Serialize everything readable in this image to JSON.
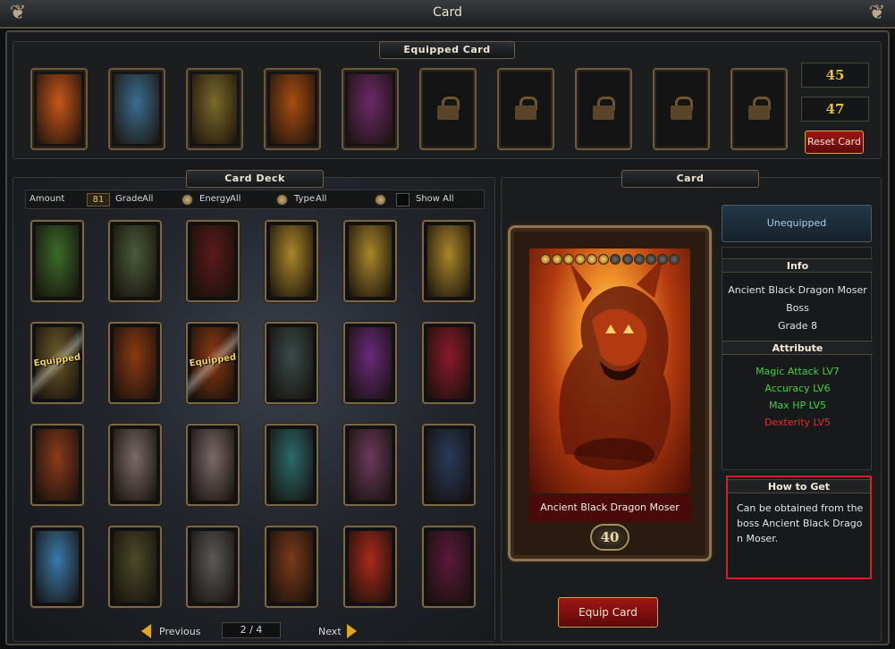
{
  "window": {
    "title": "Card"
  },
  "equipped": {
    "header": "Equipped Card",
    "slots": [
      {
        "filled": true,
        "icon": "fire-dragon-card-art",
        "color": "#c8561a"
      },
      {
        "filled": true,
        "icon": "alien-mage-card-art",
        "color": "#3a6e8f"
      },
      {
        "filled": true,
        "icon": "tiki-mask-card-art",
        "color": "#7a6a2a"
      },
      {
        "filled": true,
        "icon": "warrior-card-art",
        "color": "#a84d12"
      },
      {
        "filled": true,
        "icon": "carnivorous-plant-card-art",
        "color": "#6a2a6a"
      },
      {
        "filled": false,
        "icon": "lock-icon"
      },
      {
        "filled": false,
        "icon": "lock-icon"
      },
      {
        "filled": false,
        "icon": "lock-icon"
      },
      {
        "filled": false,
        "icon": "lock-icon"
      },
      {
        "filled": false,
        "icon": "lock-icon"
      }
    ],
    "value_top": "45",
    "value_bottom": "47",
    "reset_label": "Reset Card"
  },
  "deck": {
    "header": "Card Deck",
    "filters": {
      "amount_label": "Amount",
      "amount_value": "81",
      "grade_label": "Grade",
      "grade_value": "All",
      "energy_label": "Energy",
      "energy_value": "All",
      "type_label": "Type",
      "type_value": "All",
      "show_label": "Show All"
    },
    "cards": [
      {
        "icon": "green-beast-card-art",
        "color": "#3c6a2a",
        "equipped": false
      },
      {
        "icon": "hooded-mage-card-art",
        "color": "#4a5a3a",
        "equipped": false
      },
      {
        "icon": "dark-knight-card-art",
        "color": "#5a1a1a",
        "equipped": false
      },
      {
        "icon": "golden-orb-card-art",
        "color": "#a8862a",
        "equipped": false
      },
      {
        "icon": "golden-orb-card-art",
        "color": "#a8862a",
        "equipped": false
      },
      {
        "icon": "golden-orb-card-art",
        "color": "#a8862a",
        "equipped": false
      },
      {
        "icon": "tiki-mask-card-art",
        "color": "#6a5a2a",
        "equipped": true
      },
      {
        "icon": "warrior-card-art",
        "color": "#8a3a12",
        "equipped": false
      },
      {
        "icon": "warrior-card-art",
        "color": "#8a3a12",
        "equipped": true
      },
      {
        "icon": "armored-knight-card-art",
        "color": "#3a4a4a",
        "equipped": false
      },
      {
        "icon": "purple-demon-card-art",
        "color": "#6a2a7a",
        "equipped": false
      },
      {
        "icon": "red-demon-card-art",
        "color": "#8a1a2a",
        "equipped": false
      },
      {
        "icon": "horned-beast-card-art",
        "color": "#8a3a1a",
        "equipped": false
      },
      {
        "icon": "dwarf-card-art",
        "color": "#7a6a6a",
        "equipped": false
      },
      {
        "icon": "dwarf-card-art",
        "color": "#7a6a6a",
        "equipped": false
      },
      {
        "icon": "water-spirit-card-art",
        "color": "#2a6a6a",
        "equipped": false
      },
      {
        "icon": "winged-beast-card-art",
        "color": "#6a3a5a",
        "equipped": false
      },
      {
        "icon": "blue-soldier-card-art",
        "color": "#2a3a5a",
        "equipped": false
      },
      {
        "icon": "ice-spirit-card-art",
        "color": "#3a7aaa",
        "equipped": false
      },
      {
        "icon": "officer-card-art",
        "color": "#4a4a2a",
        "equipped": false
      },
      {
        "icon": "armored-dwarf-card-art",
        "color": "#5a5a5a",
        "equipped": false
      },
      {
        "icon": "werewolf-card-art",
        "color": "#7a3a1a",
        "equipped": false
      },
      {
        "icon": "spartan-card-art",
        "color": "#aa2a1a",
        "equipped": false
      },
      {
        "icon": "vampire-card-art",
        "color": "#5a1a3a",
        "equipped": false
      }
    ],
    "equipped_tag": "Equipped",
    "pager": {
      "previous": "Previous",
      "page": "2 / 4",
      "next": "Next"
    }
  },
  "detail": {
    "header": "Card",
    "status": "Unequipped",
    "card_name": "Ancient Black Dragon Moser",
    "card_level": "40",
    "card_icon": "black-dragon-card-art",
    "stars_filled": 6,
    "stars_total": 12,
    "info_header": "Info",
    "info_lines": [
      "Ancient Black Dragon Moser",
      "Boss",
      "Grade 8"
    ],
    "attribute_header": "Attribute",
    "attributes": [
      {
        "text": "Magic Attack LV7",
        "color": "#3fd13f"
      },
      {
        "text": "Accuracy LV6",
        "color": "#3fd13f"
      },
      {
        "text": "Max HP LV5",
        "color": "#3fd13f"
      },
      {
        "text": "Dexterity LV5",
        "color": "#e03030"
      }
    ],
    "howto_header": "How to Get",
    "howto_text": "Can be obtained from the boss Ancient Black Dragon Moser.",
    "equip_label": "Equip Card"
  }
}
